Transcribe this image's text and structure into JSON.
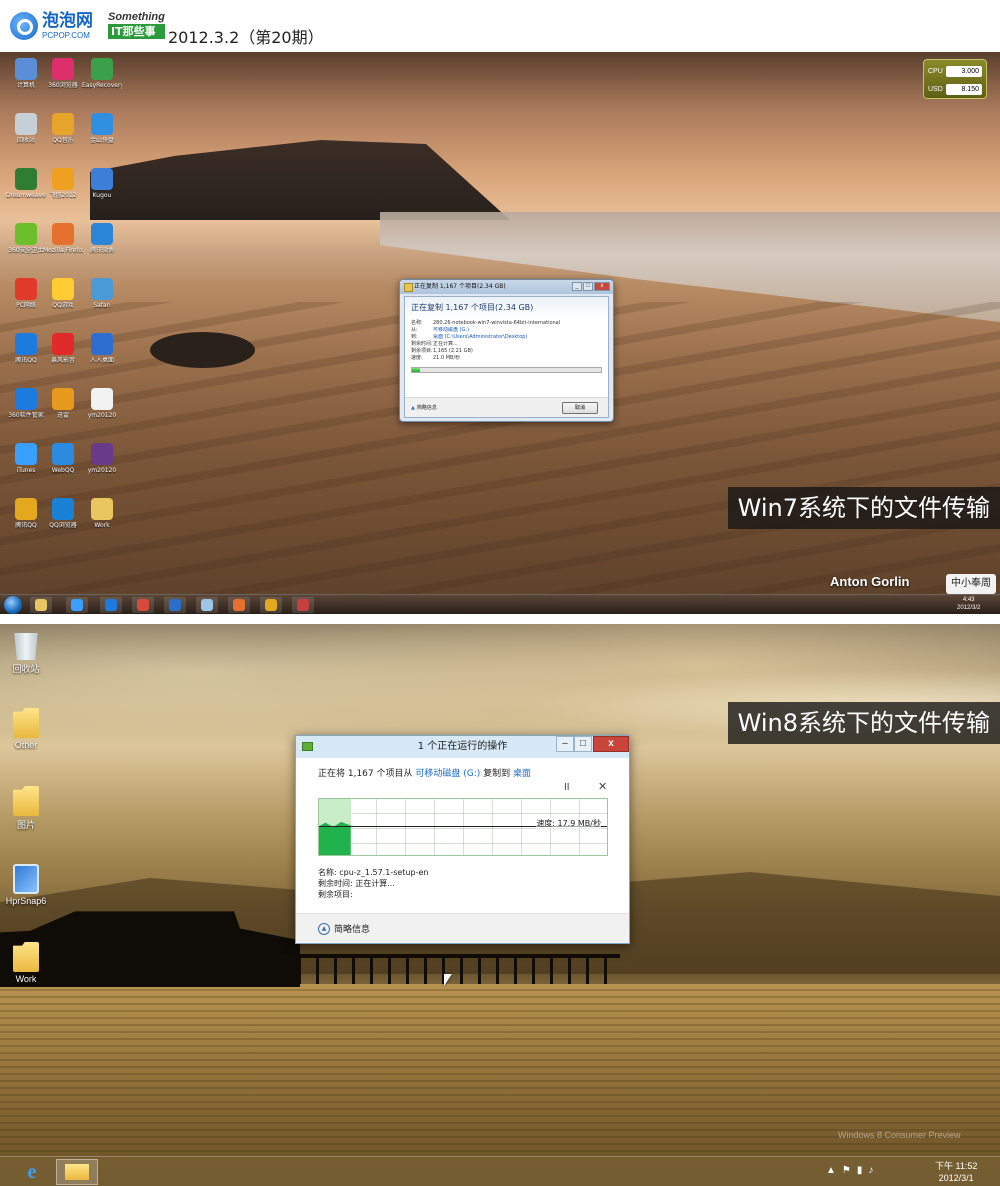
{
  "header": {
    "logo_cn": "泡泡网",
    "logo_en": "PCPOP.COM",
    "brand_top": "Something",
    "brand_bottom": "IT那些事",
    "issue": "2012.3.2（第20期）"
  },
  "win7": {
    "caption": "Win7系统下的文件传输",
    "author": "Anton Gorlin",
    "badge": "中小奉周",
    "gadget": {
      "row1_label": "CPU",
      "row1_value": "3.000",
      "row2_label": "USD",
      "row2_value": "8.150"
    },
    "desktop_icons": [
      {
        "label": "计算机",
        "color": "#5a8fd8"
      },
      {
        "label": "回收站",
        "color": "#c6ced6"
      },
      {
        "label": "Dreamweaver CS3",
        "color": "#2e7d32"
      },
      {
        "label": "360安全卫士",
        "color": "#6bbf2a"
      },
      {
        "label": "PC网络",
        "color": "#e23a2a"
      },
      {
        "label": "腾讯QQ",
        "color": "#1d7be0"
      },
      {
        "label": "360软件管家",
        "color": "#1d7be0"
      },
      {
        "label": "iTunes",
        "color": "#3aa0ff"
      },
      {
        "label": "腾讯QQ",
        "color": "#e3a81e"
      },
      {
        "label": "360浏览器",
        "color": "#dc2f6b"
      },
      {
        "label": "QQ音乐",
        "color": "#e7a32a"
      },
      {
        "label": "飞信2012",
        "color": "#f0a020"
      },
      {
        "label": "Mozilla Firefox",
        "color": "#e6702e"
      },
      {
        "label": "QQ游戏",
        "color": "#ffcc33"
      },
      {
        "label": "暴风影音",
        "color": "#e12a2a"
      },
      {
        "label": "迅雷",
        "color": "#e89a1e"
      },
      {
        "label": "WebQQ",
        "color": "#2a8be0"
      },
      {
        "label": "QQ浏览器",
        "color": "#1a82d6"
      },
      {
        "label": "EasyRecovery Professional",
        "color": "#3aa04a"
      },
      {
        "label": "金山快盘",
        "color": "#2f8fe0"
      },
      {
        "label": "Kugou",
        "color": "#3c7fd8"
      },
      {
        "label": "腾讯微博",
        "color": "#2b85d8"
      },
      {
        "label": "Safari",
        "color": "#4a9ad8"
      },
      {
        "label": "人人桌面",
        "color": "#2c6fd0"
      },
      {
        "label": "ym20120",
        "color": "#f2f2f2"
      },
      {
        "label": "ym20120",
        "color": "#6a3a8a"
      },
      {
        "label": "Work",
        "color": "#e9c660"
      }
    ],
    "dialog": {
      "title": "正在复制 1,167 个项目(2.34 GB)",
      "heading": "正在复制 1,167 个项目(2.34 GB)",
      "rows": [
        {
          "k": "名称:",
          "v": "280.26-notebook-win7-winvista-64bit-international",
          "link": false
        },
        {
          "k": "从:",
          "v": "可移动磁盘 (G:)",
          "link": true
        },
        {
          "k": "到:",
          "v": "桌面 (C:\\Users\\Administrator\\Desktop)",
          "link": true
        },
        {
          "k": "剩余时间:",
          "v": "正在计算...",
          "link": false
        },
        {
          "k": "剩余项目:",
          "v": "1,165 (2.21 GB)",
          "link": false
        },
        {
          "k": "速度:",
          "v": "21.0 MB/秒",
          "link": false
        }
      ],
      "progress": 0.04,
      "more_label": "简略信息",
      "cancel_label": "取消"
    },
    "clock": {
      "time": "4:43",
      "date": "2012/3/2"
    }
  },
  "win8": {
    "caption": "Win8系统下的文件传输",
    "watermark": "Windows 8 Consumer Preview",
    "desktop_icons": [
      {
        "label": "回收站",
        "type": "bin"
      },
      {
        "label": "Other",
        "type": "folder"
      },
      {
        "label": "图片",
        "type": "folder"
      },
      {
        "label": "HprSnap6",
        "type": "snap"
      },
      {
        "label": "Work",
        "type": "folder"
      }
    ],
    "dialog": {
      "title": "1 个正在运行的操作",
      "line_prefix": "正在将 1,167 个项目从 ",
      "line_source": "可移动磁盘 (G:)",
      "line_mid": " 复制到 ",
      "line_dest": "桌面",
      "pause": "II",
      "close": "✕",
      "speed": "速度: 17.9 MB/秒",
      "progress": 0.11,
      "name_line": "名称:  cpu-z_1.57.1-setup-en",
      "time_line": "剩余时间:  正在计算...",
      "items_line": "剩余项目:",
      "more_label": "简略信息"
    },
    "clock": {
      "time": "下午 11:52",
      "date": "2012/3/1"
    }
  }
}
